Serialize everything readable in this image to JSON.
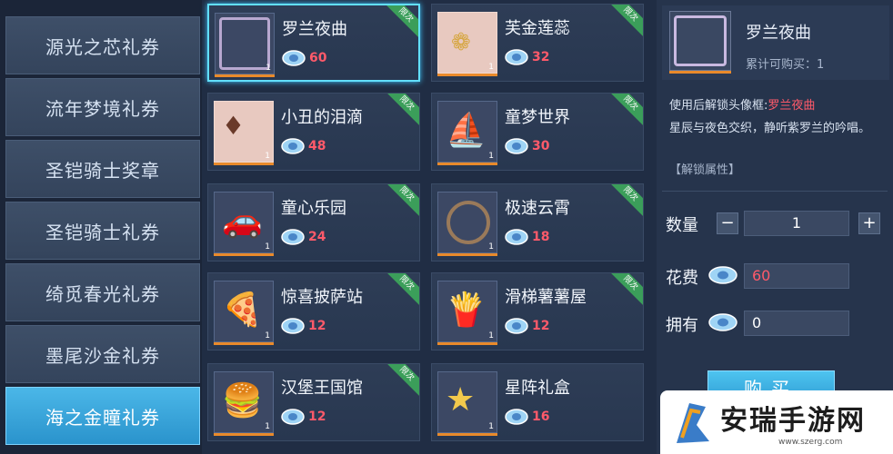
{
  "sidebar": {
    "items": [
      {
        "label": "源光之芯礼券"
      },
      {
        "label": "流年梦境礼券"
      },
      {
        "label": "圣铠骑士奖章"
      },
      {
        "label": "圣铠骑士礼券"
      },
      {
        "label": "绮觅春光礼券"
      },
      {
        "label": "墨尾沙金礼券"
      },
      {
        "label": "海之金瞳礼券"
      }
    ]
  },
  "grid": {
    "items": [
      {
        "name": "罗兰夜曲",
        "price": "60",
        "qty": "1",
        "badge": "限次",
        "icon": "avatar-frame-icon"
      },
      {
        "name": "芙金莲蕊",
        "price": "32",
        "qty": "1",
        "badge": "限次",
        "icon": "golden-lotus-icon"
      },
      {
        "name": "小丑的泪滴",
        "price": "48",
        "qty": "1",
        "badge": "限次",
        "icon": "clown-tear-icon"
      },
      {
        "name": "童梦世界",
        "price": "30",
        "qty": "1",
        "badge": "限次",
        "icon": "pirate-ship-icon"
      },
      {
        "name": "童心乐园",
        "price": "24",
        "qty": "1",
        "badge": "限次",
        "icon": "car-icon"
      },
      {
        "name": "极速云霄",
        "price": "18",
        "qty": "1",
        "badge": "限次",
        "icon": "roller-coaster-icon"
      },
      {
        "name": "惊喜披萨站",
        "price": "12",
        "qty": "1",
        "badge": "限次",
        "icon": "pizza-shop-icon"
      },
      {
        "name": "滑梯薯薯屋",
        "price": "12",
        "qty": "1",
        "badge": "限次",
        "icon": "chips-shop-icon"
      },
      {
        "name": "汉堡王国馆",
        "price": "12",
        "qty": "1",
        "badge": "限次",
        "icon": "burger-shop-icon"
      },
      {
        "name": "星阵礼盒",
        "price": "16",
        "qty": "1",
        "badge": "",
        "icon": "star-giftbox-icon"
      }
    ]
  },
  "detail": {
    "name": "罗兰夜曲",
    "limit_label": "累计可购买：1",
    "desc_prefix": "使用后解锁头像框:",
    "desc_highlight": "罗兰夜曲",
    "desc_body": "星辰与夜色交织，静听紫罗兰的吟唱。",
    "unlock": "【解锁属性】",
    "qty_label": "数量",
    "qty_value": "1",
    "minus": "−",
    "plus": "+",
    "cost_label": "花费",
    "cost_value": "60",
    "own_label": "拥有",
    "own_value": "0",
    "buy_label": "购买"
  },
  "watermark": {
    "text": "安瑞手游网",
    "url": "www.szerg.com"
  },
  "colors": {
    "accent": "#62e0ff",
    "price": "#ff5a6a",
    "active_tab": "#2a93cc",
    "limited_badge": "#3b9e5a"
  }
}
